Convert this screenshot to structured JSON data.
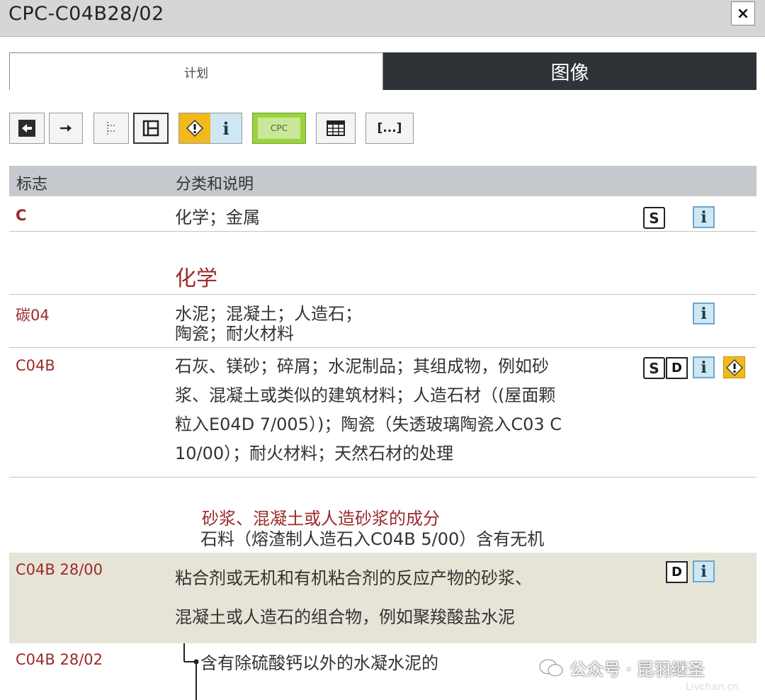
{
  "window": {
    "title": "CPC-C04B28/02",
    "close_label": "×"
  },
  "tabs": [
    {
      "label": "计划",
      "active": true
    },
    {
      "label": "图像",
      "active": false
    }
  ],
  "toolbar": {
    "buttons": [
      "back-arrow-icon",
      "forward-arrow-icon",
      "tree-icon",
      "layout-icon",
      "warning-icon",
      "info-icon",
      "cpc-icon",
      "table-icon",
      "ellipsis-icon"
    ],
    "cpc_label": "CPC",
    "ellipsis_label": "[...]"
  },
  "table": {
    "headers": {
      "symbol": "标志",
      "description": "分类和说明"
    },
    "rows": [
      {
        "symbol": "C",
        "description": "化学；金属",
        "icons": [
          "s",
          "i"
        ]
      },
      {
        "heading": "化学"
      },
      {
        "symbol": "碳04",
        "description_lines": [
          "水泥；混凝土；人造石；",
          "陶瓷；耐火材料"
        ],
        "icons": [
          "i"
        ]
      },
      {
        "symbol": "C04B",
        "description_lines": [
          "石灰、镁砂；碎屑；水泥制品；其组成物，例如砂",
          "浆、混凝土或类似的建筑材料；人造石材（(屋面颗",
          "粒入E04D 7/005）)；陶瓷（失透玻璃陶瓷入C03 C",
          "10/00）；耐火材料；天然石材的处理"
        ],
        "icons": [
          "s",
          "d",
          "i",
          "!"
        ]
      },
      {
        "subheading": "砂浆、混凝土或人造砂浆的成分",
        "subtext": "石料（熔渣制人造石入C04B 5/00）含有无机"
      },
      {
        "symbol": "C04B 28/00",
        "description_lines": [
          "粘合剂或无机和有机粘合剂的反应产物的砂浆、",
          "混凝土或人造石的组合物，例如聚羧酸盐水泥"
        ],
        "icons": [
          "d",
          "i"
        ]
      },
      {
        "symbol": "C04B 28/02",
        "description": "含有除硫酸钙以外的水凝水泥的"
      }
    ]
  },
  "icon_labels": {
    "s": "S",
    "d": "D",
    "i": "i",
    "warn": "!"
  },
  "watermark": {
    "text": "公众号 · 昆羽继圣",
    "sub": "Livchan.cn"
  },
  "colors": {
    "symbol_red": "#9a2a2a",
    "header_gray": "#c5c8cd",
    "tab_dark": "#2f3338",
    "highlight_row": "#e6e4d6",
    "info_blue": "#cfe6f3",
    "warn_yellow": "#f2b91a"
  }
}
